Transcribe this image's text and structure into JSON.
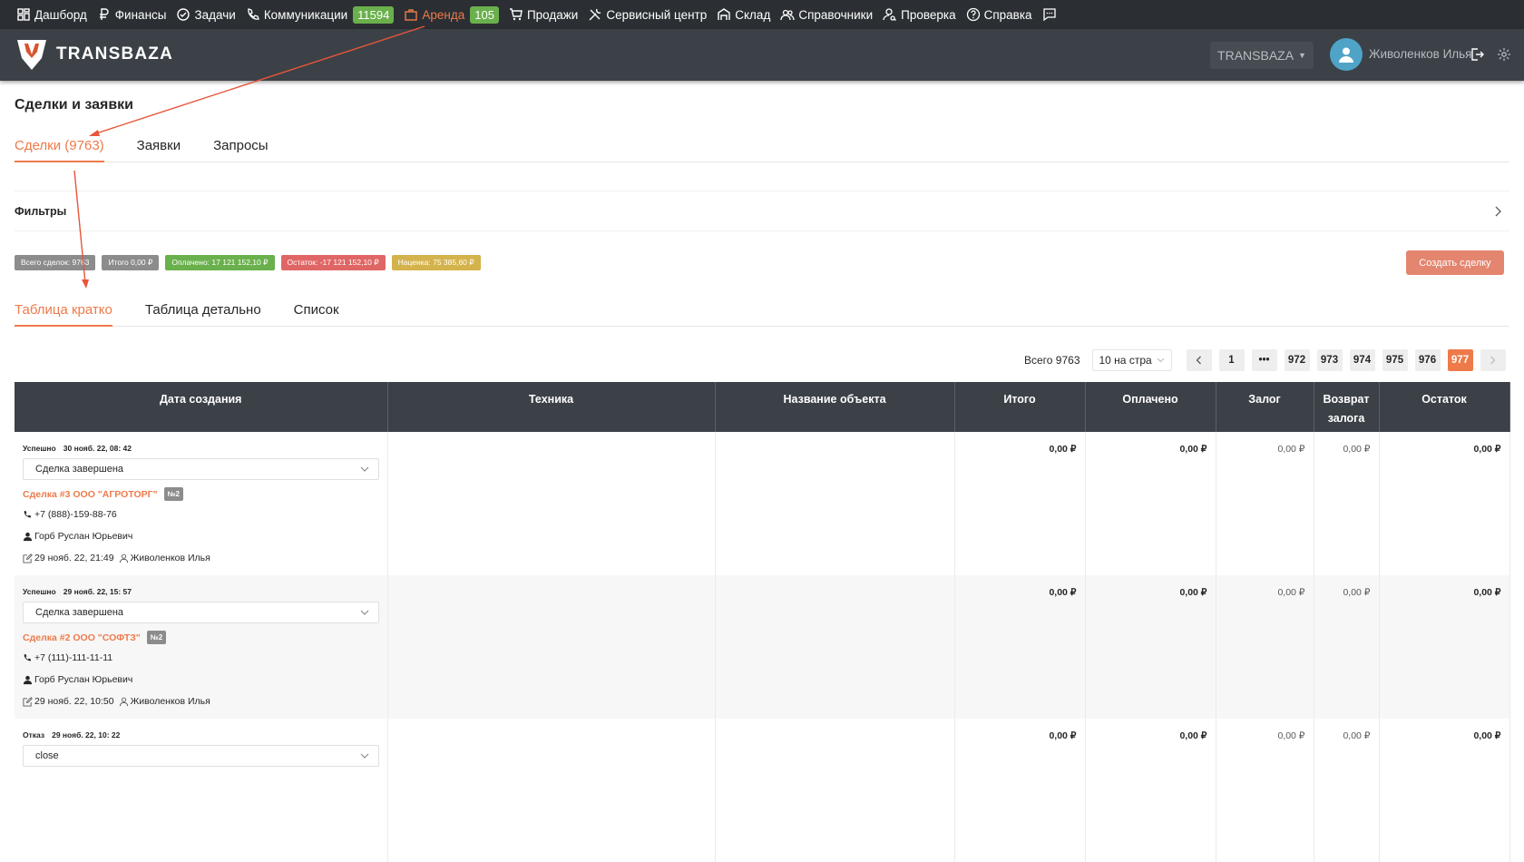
{
  "topnav": {
    "items": [
      {
        "label": "Дашборд",
        "icon": "dashboard-icon"
      },
      {
        "label": "Финансы",
        "icon": "ruble-icon"
      },
      {
        "label": "Задачи",
        "icon": "check-circle-icon"
      },
      {
        "label": "Коммуникации",
        "icon": "phone-icon",
        "badge": "11594"
      },
      {
        "label": "Аренда",
        "icon": "briefcase-icon",
        "badge": "105"
      },
      {
        "label": "Продажи",
        "icon": "cart-icon"
      },
      {
        "label": "Сервисный центр",
        "icon": "tools-icon"
      },
      {
        "label": "Склад",
        "icon": "warehouse-icon"
      },
      {
        "label": "Справочники",
        "icon": "users-icon"
      },
      {
        "label": "Проверка",
        "icon": "user-search-icon"
      },
      {
        "label": "Справка",
        "icon": "help-icon"
      }
    ]
  },
  "header": {
    "logo_text": "TRANSBAZA",
    "company": "TRANSBAZA",
    "user_name": "Живоленков Илья"
  },
  "page": {
    "title": "Сделки и заявки",
    "tabs": [
      "Сделки (9763)",
      "Заявки",
      "Запросы"
    ],
    "filters_label": "Фильтры"
  },
  "summary": {
    "pills": [
      {
        "label": "Всего сделок: 9763",
        "color": "#8c8c8c"
      },
      {
        "label": "Итого 0,00 ₽",
        "color": "#8c8c8c"
      },
      {
        "label": "Оплачено: 17 121 152,10 ₽",
        "color": "#6ab04c"
      },
      {
        "label": "Остаток: -17 121 152,10 ₽",
        "color": "#e06666"
      },
      {
        "label": "Наценка: 75 385,60 ₽",
        "color": "#d4b24c"
      }
    ],
    "create_button": "Создать сделку"
  },
  "view_tabs": [
    "Таблица кратко",
    "Таблица детально",
    "Список"
  ],
  "pagination": {
    "total": "Всего 9763",
    "per_page": "10 на стра",
    "pages": [
      "1",
      "•••",
      "972",
      "973",
      "974",
      "975",
      "976",
      "977"
    ],
    "current": "977"
  },
  "table": {
    "headers": [
      "Дата создания",
      "Техника",
      "Название объекта",
      "Итого",
      "Оплачено",
      "Залог",
      "Возврат залога",
      "Остаток"
    ],
    "rows": [
      {
        "status": "Успешно",
        "created": "30 нояб. 22, 08: 42",
        "select_value": "Сделка завершена",
        "deal": "Сделка #3 ООО \"АГРОТОРГ\"",
        "badge": "№2",
        "phone": "+7 (888)-159-88-76",
        "contact": "Горб Руслан Юрьевич",
        "edited": "29 нояб. 22, 21:49",
        "manager": "Живоленков Илья",
        "total": "0,00 ₽",
        "paid": "0,00 ₽",
        "deposit": "0,00 ₽",
        "deposit_return": "0,00 ₽",
        "balance": "0,00 ₽"
      },
      {
        "status": "Успешно",
        "created": "29 нояб. 22, 15: 57",
        "select_value": "Сделка завершена",
        "deal": "Сделка #2 ООО \"СОФТЗ\"",
        "badge": "№2",
        "phone": "+7 (111)-111-11-11",
        "contact": "Горб Руслан Юрьевич",
        "edited": "29 нояб. 22, 10:50",
        "manager": "Живоленков Илья",
        "total": "0,00 ₽",
        "paid": "0,00 ₽",
        "deposit": "0,00 ₽",
        "deposit_return": "0,00 ₽",
        "balance": "0,00 ₽"
      },
      {
        "status": "Отказ",
        "created": "29 нояб. 22, 10: 22",
        "select_value": "close",
        "total": "0,00 ₽",
        "paid": "0,00 ₽",
        "deposit": "0,00 ₽",
        "deposit_return": "0,00 ₽",
        "balance": "0,00 ₽"
      }
    ]
  },
  "colors": {
    "accent": "#ee7a4a",
    "nav_bg": "#2b2f33",
    "header_bg": "#3b4147",
    "annotation": "#e8553a"
  }
}
